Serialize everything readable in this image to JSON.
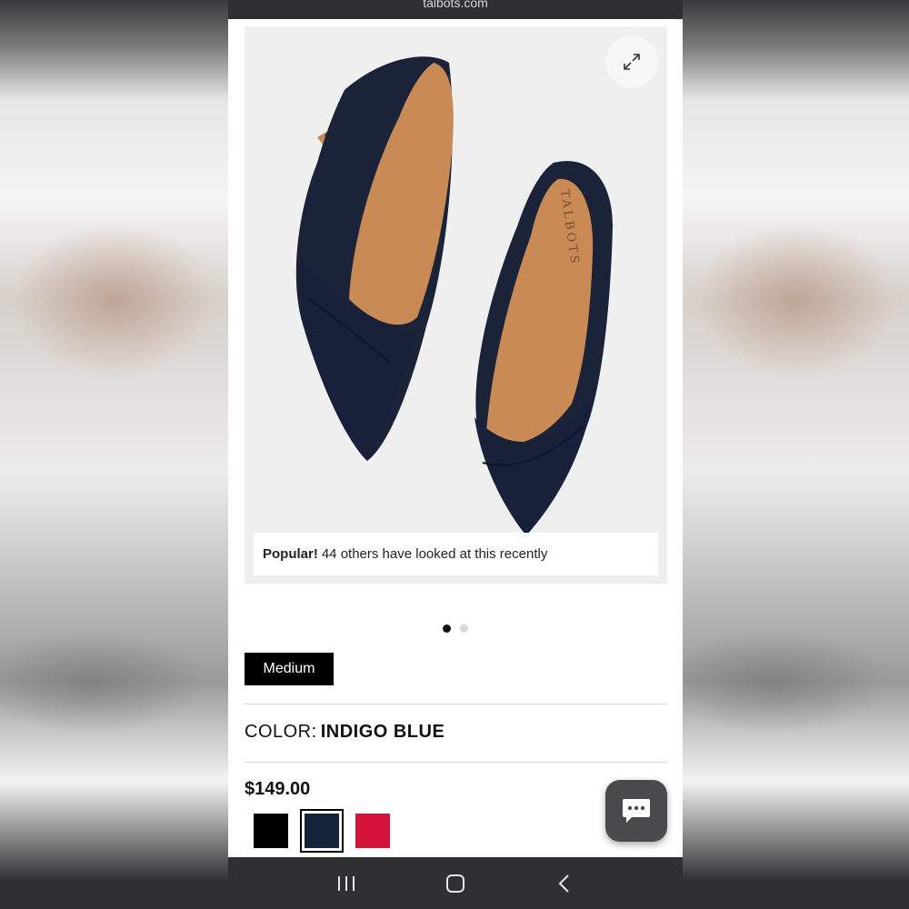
{
  "browser": {
    "url": "talbots.com"
  },
  "gallery": {
    "brand_stamp": "TALBOTS",
    "popular": {
      "label": "Popular!",
      "text": "44 others have looked at this recently"
    },
    "dots": {
      "count": 2,
      "active_index": 0
    }
  },
  "product": {
    "size_chip": "Medium",
    "color_label": "COLOR:",
    "color_value": "INDIGO BLUE",
    "price": "$149.00",
    "swatches": [
      {
        "name": "black",
        "color": "#000000",
        "selected": false
      },
      {
        "name": "indigo-blue",
        "color": "#14223a",
        "selected": true
      },
      {
        "name": "red",
        "color": "#d5123a",
        "selected": false
      }
    ]
  },
  "colors": {
    "shoe_suede": "#1b2338",
    "shoe_lining": "#c98a55",
    "nav_bar": "#2f3033",
    "chat_button": "#4a4a4c"
  },
  "icons": {
    "expand": "expand-icon",
    "chat": "chat-bubble-icon",
    "nav_recents": "recents-icon",
    "nav_home": "home-icon",
    "nav_back": "back-icon"
  }
}
